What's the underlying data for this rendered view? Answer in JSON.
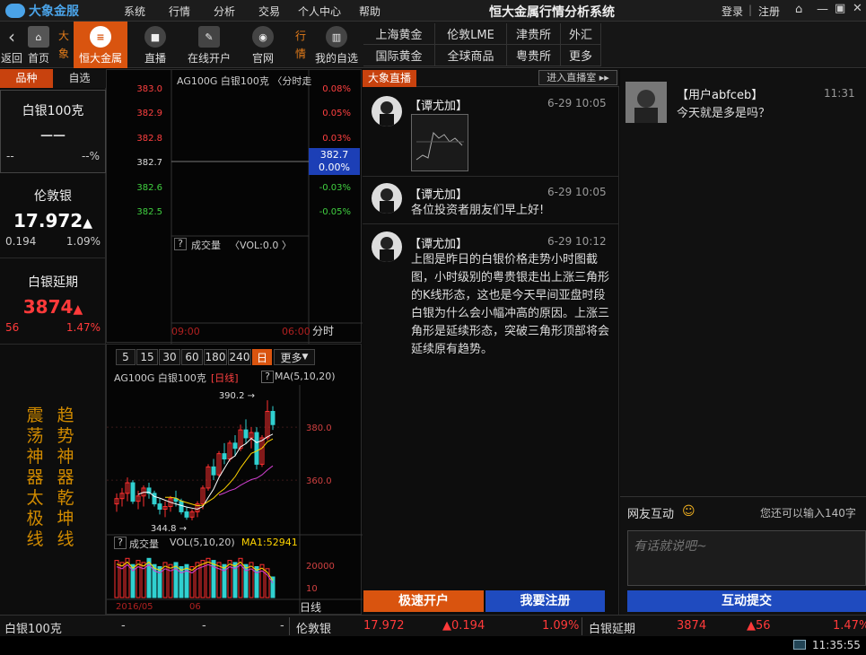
{
  "app": {
    "brand": "大象金服",
    "title": "恒大金属行情分析系统",
    "auth_login": "登录",
    "auth_sep": "|",
    "auth_register": "注册"
  },
  "menu": [
    "系统",
    "行情",
    "分析",
    "交易",
    "个人中心",
    "帮助"
  ],
  "toolbar": {
    "back": "返回",
    "home": "首页",
    "side_label_1": "大",
    "side_label_2": "象",
    "hengda": "恒大金属",
    "live": "直播",
    "open_account": "在线开户",
    "website": "官网",
    "quote_label_1": "行",
    "quote_label_2": "情",
    "watchlist": "我的自选"
  },
  "markets": [
    "上海黄金",
    "伦敦LME",
    "津贵所",
    "外汇",
    "国际黄金",
    "全球商品",
    "粤贵所",
    "更多"
  ],
  "left": {
    "tab_varieties": "品种",
    "tab_watch": "自选",
    "cards": [
      {
        "name": "白银100克",
        "price": "——",
        "change": "--",
        "pct": "--%"
      },
      {
        "name": "伦敦银",
        "price": "17.972",
        "arrow": "▲",
        "change": "0.194",
        "pct": "1.09%"
      },
      {
        "name": "白银延期",
        "price": "3874",
        "arrow": "▲",
        "change": "56",
        "pct": "1.47%"
      }
    ],
    "promo_col1": [
      "震",
      "荡",
      "神",
      "器",
      "太",
      "极",
      "线"
    ],
    "promo_col2": [
      "趋",
      "势",
      "神",
      "器",
      "乾",
      "坤",
      "线"
    ]
  },
  "timechart": {
    "header": "AG100G 白银100克 〈分时走",
    "prices": [
      "383.0",
      "382.9",
      "382.8",
      "382.7",
      "382.6",
      "382.5"
    ],
    "pcts": [
      "0.08%",
      "0.05%",
      "0.03%",
      "",
      "-0.03%",
      "-0.05%"
    ],
    "current_price": "382.7",
    "current_pct": "0.00%",
    "vol_label": "成交量",
    "vol_value": "〈VOL:0.0 〉",
    "time_start": "09:00",
    "time_end": "06:00",
    "mode": "分时",
    "question": "?"
  },
  "kchart": {
    "periods": [
      "5",
      "15",
      "30",
      "60",
      "180",
      "240",
      "日"
    ],
    "more": "更多",
    "header": "AG100G 白银100克",
    "period_tag": "[日线]",
    "ma": "MA(5,10,20)",
    "high_label": "390.2",
    "low_label": "344.8",
    "y_labels": [
      "380.0",
      "360.0"
    ],
    "vol_label": "成交量",
    "vol_ma": "VOL(5,10,20)",
    "vol_ma1": "MA1:52941.",
    "vol_y": [
      "20000",
      "10"
    ],
    "dates": [
      "2016/05",
      "06"
    ],
    "mode": "日线",
    "question": "?",
    "chart_data": {
      "type": "candlestick",
      "ylim": [
        340,
        395
      ],
      "candles": [
        [
          351,
          355,
          348,
          353
        ],
        [
          353,
          357,
          350,
          355
        ],
        [
          355,
          361,
          352,
          359
        ],
        [
          359,
          360,
          351,
          352
        ],
        [
          352,
          356,
          349,
          354
        ],
        [
          354,
          358,
          350,
          357
        ],
        [
          357,
          359,
          353,
          355
        ],
        [
          355,
          356,
          350,
          351
        ],
        [
          351,
          353,
          347,
          349
        ],
        [
          349,
          352,
          346,
          350
        ],
        [
          350,
          354,
          348,
          353
        ],
        [
          353,
          356,
          350,
          352
        ],
        [
          352,
          353,
          347,
          348
        ],
        [
          348,
          350,
          345,
          346
        ],
        [
          346,
          349,
          344.8,
          348
        ],
        [
          348,
          352,
          346,
          351
        ],
        [
          351,
          358,
          349,
          357
        ],
        [
          357,
          366,
          356,
          365
        ],
        [
          365,
          368,
          360,
          362
        ],
        [
          362,
          371,
          361,
          370
        ],
        [
          370,
          374,
          366,
          368
        ],
        [
          368,
          375,
          367,
          374
        ],
        [
          374,
          377,
          369,
          372
        ],
        [
          372,
          381,
          371,
          379
        ],
        [
          379,
          383,
          374,
          376
        ],
        [
          376,
          380,
          372,
          378
        ],
        [
          378,
          380,
          364,
          366
        ],
        [
          366,
          377,
          365,
          376
        ],
        [
          376,
          390.2,
          375,
          386
        ],
        [
          386,
          388,
          379,
          381
        ]
      ],
      "volumes": [
        18,
        17,
        19,
        16,
        18,
        17,
        19,
        16,
        15,
        17,
        16,
        17,
        15,
        16,
        15,
        17,
        18,
        19,
        18,
        17,
        16,
        18,
        17,
        19,
        16,
        17,
        15,
        16,
        14,
        10
      ]
    }
  },
  "chat": {
    "tab": "大象直播",
    "enter_room": "进入直播室",
    "messages": [
      {
        "name": "【谭尤加】",
        "time": "6-29 10:05",
        "text": "",
        "has_image": true
      },
      {
        "name": "【谭尤加】",
        "time": "6-29 10:05",
        "text": "各位投资者朋友们早上好!"
      },
      {
        "name": "【谭尤加】",
        "time": "6-29 10:12",
        "text": "上图是昨日的白银价格走势小时图截图，小时级别的粤贵银走出上涨三角形的K线形态，这也是今天早间亚盘时段白银为什么会小幅冲高的原因。上涨三角形是延续形态，突破三角形顶部将会延续原有趋势。"
      }
    ],
    "btn_open": "极速开户",
    "btn_register": "我要注册"
  },
  "interact": {
    "user_name": "【用户abfceb】",
    "user_time": "11:31",
    "user_text": "今天就是多是吗？",
    "label": "网友互动",
    "remaining": "您还可以输入140字",
    "placeholder": "有话就说吧~",
    "submit": "互动提交"
  },
  "status": {
    "item1_name": "白银100克",
    "item1_v1": "-",
    "item1_v2": "-",
    "item1_v3": "-",
    "item2_name": "伦敦银",
    "item2_price": "17.972",
    "item2_change": "0.194",
    "item2_pct": "1.09%",
    "item3_name": "白银延期",
    "item3_price": "3874",
    "item3_change": "56",
    "item3_pct": "1.47%",
    "clock": "11:35:55"
  }
}
